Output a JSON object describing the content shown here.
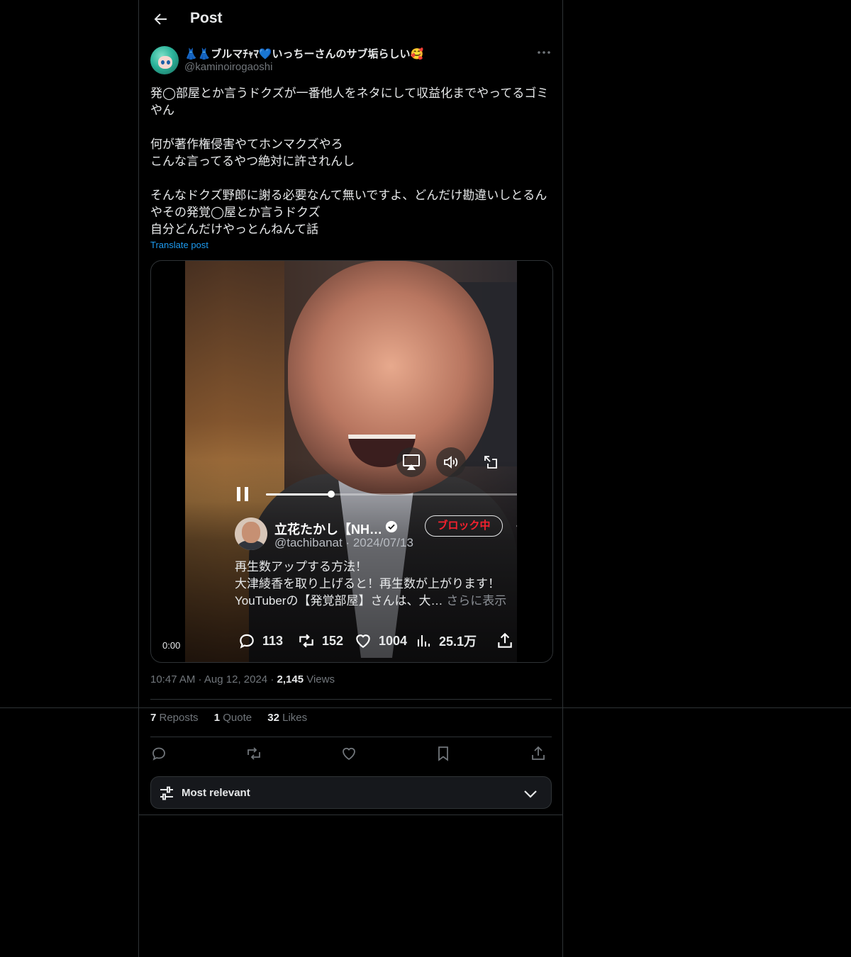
{
  "header": {
    "title": "Post"
  },
  "post": {
    "display_name": "👗👗ブルマﾁｬﾏ💙いっちーさんのサブ垢らしい🥰",
    "handle": "@kaminoirogaoshi",
    "text": "発◯部屋とか言うドクズが一番他人をネタにして収益化までやってるゴミやん\n\n何が著作権侵害やてホンマクズやろ\nこんな言ってるやつ絶対に許されんし\n\nそんなドクズ野郎に謝る必要なんて無いですよ、どんだけ勘違いしとるんやその発覚◯屋とか言うドクズ\n自分どんだけやっとんねんて話",
    "translate_label": "Translate post"
  },
  "video": {
    "time": "0:00",
    "progress": 0.24,
    "embedded": {
      "name": "立花たかし【NH…",
      "handle_date": "@tachibanat · 2024/07/13",
      "block_label": "ブロック中",
      "text": "再生数アップする方法！\n大津綾香を取り上げると！再生数が上がります！\nYouTuberの【発覚部屋】さんは、大… ",
      "show_more": "さらに表示",
      "replies": "113",
      "reposts": "152",
      "likes": "1004",
      "views": "25.1万"
    }
  },
  "meta": {
    "time": "10:47 AM",
    "sep1": " · ",
    "date": "Aug 12, 2024",
    "sep2": " · ",
    "views_count": "2,145",
    "views_label": " Views"
  },
  "counts": {
    "reposts_n": "7",
    "reposts_l": " Reposts",
    "quotes_n": "1",
    "quotes_l": " Quote",
    "likes_n": "32",
    "likes_l": " Likes"
  },
  "sort": {
    "label": "Most relevant"
  },
  "colors": {
    "accent": "#1d9bf0",
    "muted": "#71767b",
    "border": "#2f3336",
    "block_red": "#f4212e"
  }
}
